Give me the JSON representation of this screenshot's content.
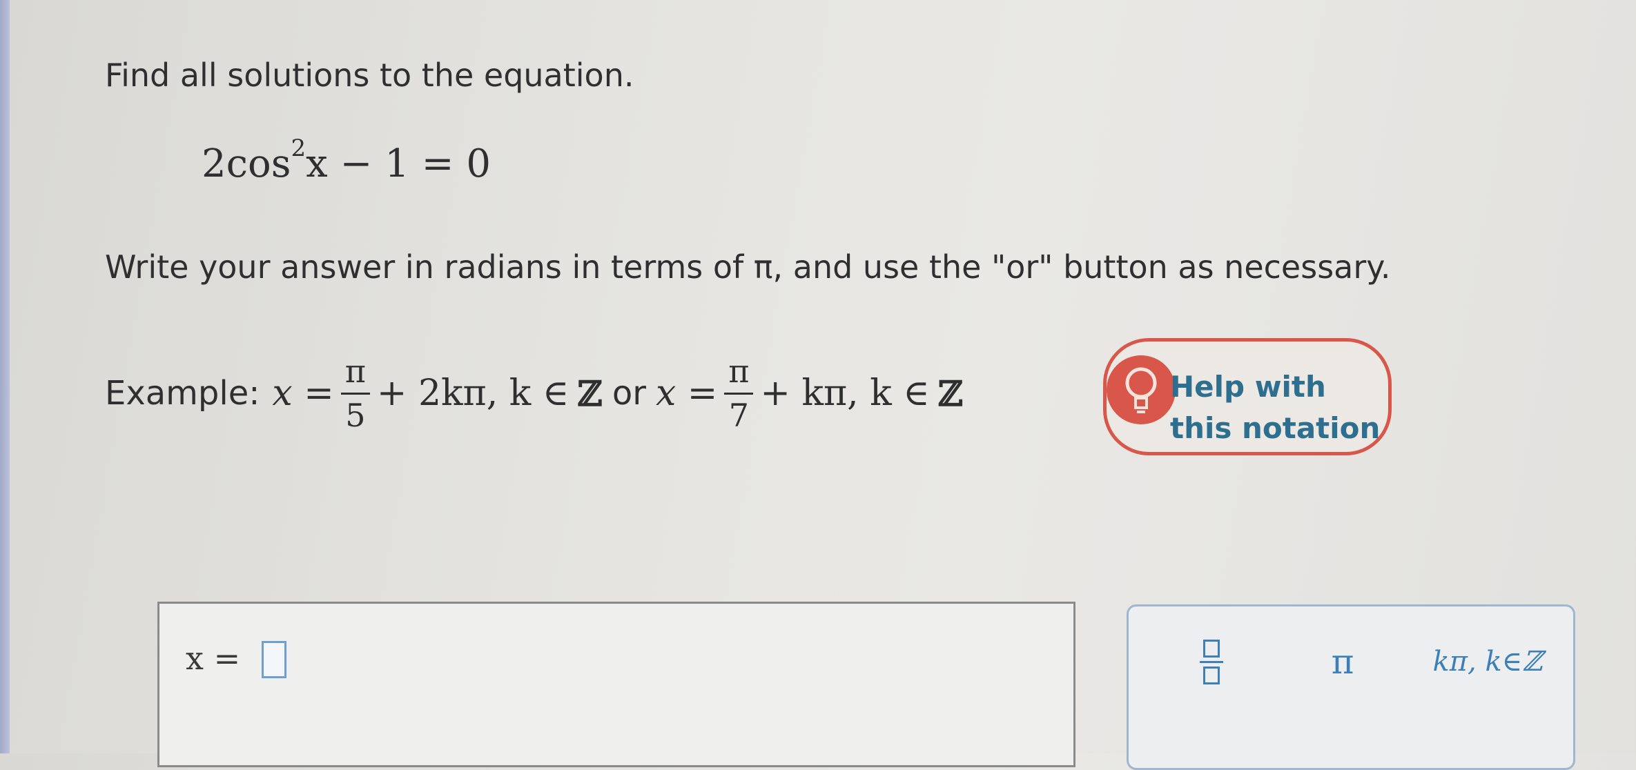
{
  "question": {
    "prompt": "Find all solutions to the equation.",
    "equation": {
      "coefficient": "2",
      "func": "cos",
      "exponent": "2",
      "rest": "x − 1 = 0"
    },
    "instruction": "Write your answer in radians in terms of π, and use the \"or\" button as necessary."
  },
  "example": {
    "label": "Example:",
    "lhs1": "x =",
    "frac1_num": "π",
    "frac1_den": "5",
    "tail1": "+ 2kπ, k ∈",
    "set1": "ℤ",
    "or_label": "or",
    "lhs2": "x =",
    "frac2_num": "π",
    "frac2_den": "7",
    "tail2": "+ kπ, k ∈",
    "set2": "ℤ"
  },
  "help": {
    "icon": "lightbulb-icon",
    "label": "Help with this notation",
    "color": "#d8574a"
  },
  "answer": {
    "label": "x =",
    "value": ""
  },
  "palette": {
    "fraction_icon": "fraction-icon",
    "pi_label": "π",
    "kpi_label": "kπ, k∈ℤ",
    "accent": "#3d7fb8"
  }
}
